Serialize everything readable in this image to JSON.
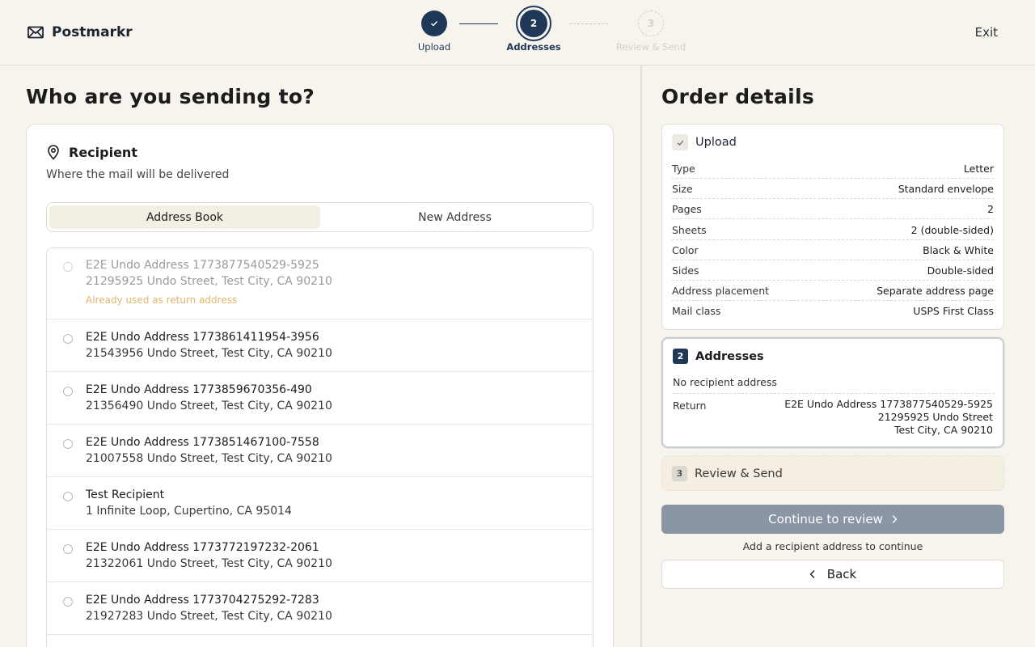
{
  "app": {
    "name": "Postmarkr",
    "exit_label": "Exit"
  },
  "stepper": {
    "steps": [
      {
        "number": "",
        "label": "Upload",
        "state": "complete"
      },
      {
        "number": "2",
        "label": "Addresses",
        "state": "current"
      },
      {
        "number": "3",
        "label": "Review & Send",
        "state": "upcoming"
      }
    ]
  },
  "main": {
    "title": "Who are you sending to?",
    "recipient": {
      "title": "Recipient",
      "subtitle": "Where the mail will be delivered",
      "tabs": {
        "address_book": "Address Book",
        "new_address": "New Address",
        "active": "address_book"
      },
      "addresses": [
        {
          "name": "E2E Undo Address 1773877540529-5925",
          "address": "21295925 Undo Street, Test City, CA 90210",
          "disabled": true,
          "note": "Already used as return address"
        },
        {
          "name": "E2E Undo Address 1773861411954-3956",
          "address": "21543956 Undo Street, Test City, CA 90210",
          "disabled": false,
          "note": ""
        },
        {
          "name": "E2E Undo Address 1773859670356-490",
          "address": "21356490 Undo Street, Test City, CA 90210",
          "disabled": false,
          "note": ""
        },
        {
          "name": "E2E Undo Address 1773851467100-7558",
          "address": "21007558 Undo Street, Test City, CA 90210",
          "disabled": false,
          "note": ""
        },
        {
          "name": "Test Recipient",
          "address": "1 Infinite Loop, Cupertino, CA 95014",
          "disabled": false,
          "note": ""
        },
        {
          "name": "E2E Undo Address 1773772197232-2061",
          "address": "21322061 Undo Street, Test City, CA 90210",
          "disabled": false,
          "note": ""
        },
        {
          "name": "E2E Undo Address 1773704275292-7283",
          "address": "21927283 Undo Street, Test City, CA 90210",
          "disabled": false,
          "note": ""
        }
      ]
    }
  },
  "order": {
    "title": "Order details",
    "upload": {
      "label": "Upload",
      "details": [
        {
          "key": "Type",
          "value": "Letter"
        },
        {
          "key": "Size",
          "value": "Standard envelope"
        },
        {
          "key": "Pages",
          "value": "2"
        },
        {
          "key": "Sheets",
          "value": "2 (double-sided)"
        },
        {
          "key": "Color",
          "value": "Black & White"
        },
        {
          "key": "Sides",
          "value": "Double-sided"
        },
        {
          "key": "Address placement",
          "value": "Separate address page"
        },
        {
          "key": "Mail class",
          "value": "USPS First Class"
        }
      ]
    },
    "addresses": {
      "number": "2",
      "label": "Addresses",
      "no_recipient": "No recipient address",
      "return_label": "Return",
      "return_lines": [
        "E2E Undo Address 1773877540529-5925",
        "21295925 Undo Street",
        "Test City, CA 90210"
      ]
    },
    "review": {
      "number": "3",
      "label": "Review & Send"
    },
    "continue_label": "Continue to review",
    "hint": "Add a recipient address to continue",
    "back_label": "Back"
  },
  "colors": {
    "accent": "#1f3858",
    "disabled_button": "#8a96a3",
    "warning_note": "#e2b66a",
    "background": "#f7f4ee"
  },
  "icons": {
    "logo": "envelope-icon",
    "recipient": "map-pin-icon",
    "check": "check-icon",
    "chevron_right": "chevron-right-icon",
    "chevron_left": "chevron-left-icon"
  }
}
